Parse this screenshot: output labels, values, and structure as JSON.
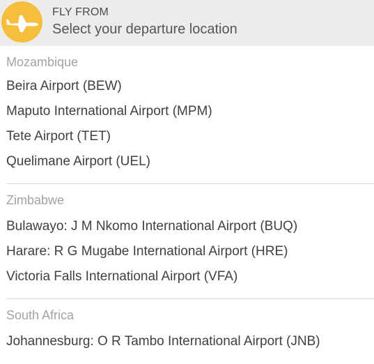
{
  "header": {
    "label": "FLY FROM",
    "subtitle": "Select your departure location",
    "icon": "airplane-icon",
    "accent_color": "#f7bd3c"
  },
  "groups": [
    {
      "country": "Mozambique",
      "airports": [
        "Beira Airport (BEW)",
        "Maputo International Airport (MPM)",
        "Tete Airport (TET)",
        "Quelimane Airport (UEL)"
      ]
    },
    {
      "country": "Zimbabwe",
      "airports": [
        "Bulawayo: J M Nkomo International Airport (BUQ)",
        "Harare: R G Mugabe International Airport (HRE)",
        "Victoria Falls International Airport (VFA)"
      ]
    },
    {
      "country": "South Africa",
      "airports": [
        "Johannesburg: O R Tambo International Airport (JNB)"
      ]
    }
  ]
}
